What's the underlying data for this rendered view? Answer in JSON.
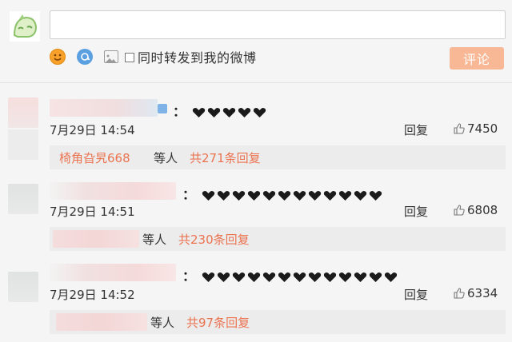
{
  "composer": {
    "input_value": "",
    "repost_label": "同时转发到我的微博",
    "repost_checked": false,
    "submit_label": "评论",
    "icons": [
      "emoji-icon",
      "topic-icon",
      "image-icon"
    ]
  },
  "comments": [
    {
      "text": "：",
      "emoji_count": 5,
      "time": "7月29日 14:54",
      "reply_label": "回复",
      "likes": "7450",
      "reply_user": "椅角旮旯668",
      "reply_others": "等人",
      "reply_total": "共271条回复"
    },
    {
      "text": "：",
      "emoji_count": 12,
      "time": "7月29日 14:51",
      "reply_label": "回复",
      "likes": "6808",
      "reply_others": "等人",
      "reply_total": "共230条回复"
    },
    {
      "text": "：",
      "emoji_count": 13,
      "time": "7月29日 14:52",
      "reply_label": "回复",
      "likes": "6334",
      "reply_others": "等人",
      "reply_total": "共97条回复"
    }
  ],
  "colors": {
    "accent": "#eb7350",
    "submit_bg": "#f8b795",
    "reply_bar": "#ececec"
  }
}
